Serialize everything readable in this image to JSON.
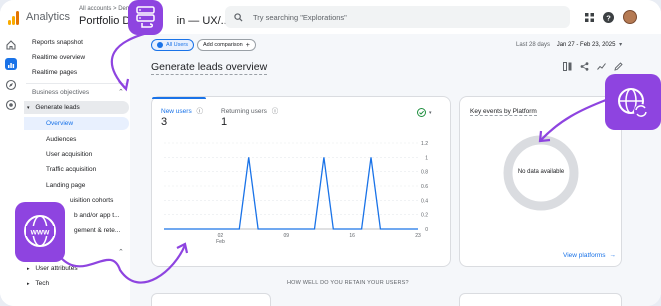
{
  "topbar": {
    "app_name": "Analytics",
    "breadcrumb": "All accounts > Demo",
    "property_name": "Portfolio Dem",
    "property_suffix": "in — UX/...",
    "search_placeholder": "Try searching \"Explorations\""
  },
  "sidebar": {
    "items": [
      {
        "label": "Reports snapshot"
      },
      {
        "label": "Realtime overview"
      },
      {
        "label": "Realtime pages"
      }
    ],
    "section_label": "Business objectives",
    "group_label": "Generate leads",
    "sub_items": [
      {
        "label": "Overview"
      },
      {
        "label": "Audiences"
      },
      {
        "label": "User acquisition"
      },
      {
        "label": "Traffic acquisition"
      },
      {
        "label": "Landing page"
      },
      {
        "label": "uisition cohorts"
      },
      {
        "label": "b and/or app t..."
      },
      {
        "label": "gement & rete..."
      }
    ],
    "bottom_items": [
      {
        "label": "User attributes"
      },
      {
        "label": "Tech"
      }
    ]
  },
  "main": {
    "all_users_chip": "All Users",
    "add_comparison_chip": "Add comparison",
    "date_label": "Last 28 days",
    "date_range": "Jan 27 - Feb 23, 2025",
    "page_title": "Generate leads overview",
    "retain_heading": "HOW WELL DO YOU RETAIN YOUR USERS?"
  },
  "users_card": {
    "tab_new_label": "New users",
    "tab_new_value": "3",
    "tab_returning_label": "Returning users",
    "tab_returning_value": "1"
  },
  "chart_data": {
    "type": "line",
    "x": [
      "Feb 2",
      "Feb 9",
      "Feb 16",
      "Feb 23"
    ],
    "xtick_labels": [
      "02",
      "09",
      "16",
      "23"
    ],
    "xtick_month": "Feb",
    "yticks": [
      "1.2",
      "1",
      "0.8",
      "0.6",
      "0.4",
      "0.2",
      "0"
    ],
    "ylim": [
      0,
      1.2
    ],
    "series": [
      {
        "values": [
          0,
          0,
          0,
          0,
          0,
          0,
          0,
          0,
          0,
          1,
          0,
          0,
          0,
          0,
          0,
          0,
          0,
          1,
          0,
          0,
          0,
          0,
          1,
          0,
          0,
          0,
          0,
          0
        ],
        "color": "#1a73e8"
      }
    ],
    "grid": true
  },
  "platform_card": {
    "title": "Key events by Platform",
    "no_data": "No data available",
    "link": "View platforms"
  },
  "colors": {
    "accent": "#1a73e8",
    "overlay": "#8e44e0",
    "highlight": "#e8f0fe",
    "check": "#1e8e3e"
  }
}
